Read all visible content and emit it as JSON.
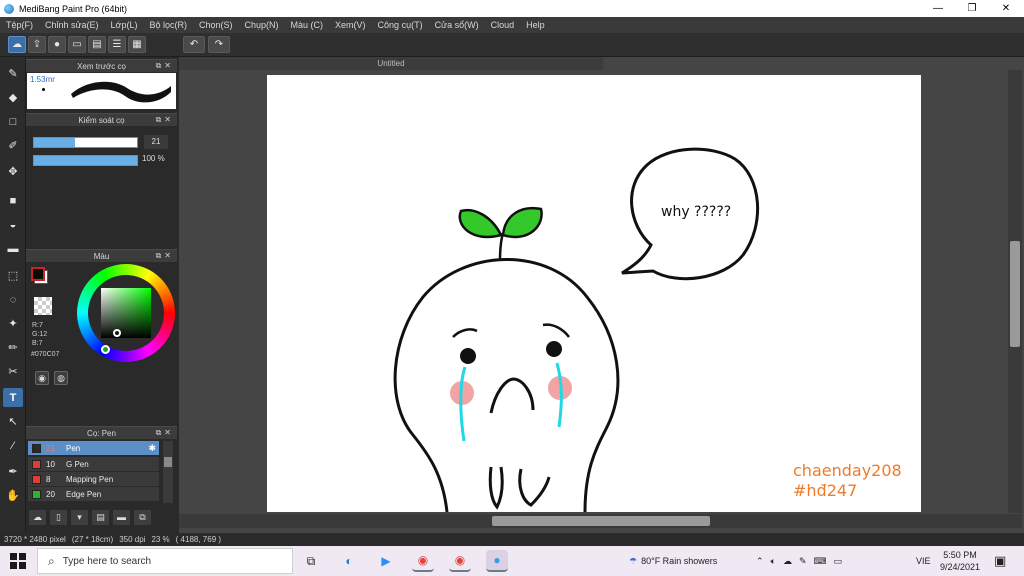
{
  "window": {
    "title": "MediBang Paint Pro (64bit)",
    "controls": [
      "—",
      "❐",
      "✕"
    ]
  },
  "menu": [
    "Tệp(F)",
    "Chỉnh sửa(E)",
    "Lớp(L)",
    "Bộ lọc(R)",
    "Chọn(S)",
    "Chụp(N)",
    "Màu (C)",
    "Xem(V)",
    "Công cụ(T)",
    "Cửa sổ(W)",
    "Cloud",
    "Help"
  ],
  "toolbar": {
    "icons": [
      "cloud-icon",
      "share-icon",
      "comment-icon",
      "chat-icon",
      "doc-icon",
      "list-icon",
      "grid-icon",
      "undo-icon",
      "redo-icon"
    ]
  },
  "tools": {
    "active": "text-tool",
    "items": [
      "brush-tool",
      "eraser-tool",
      "shape-tool",
      "pen-tool",
      "move-tool",
      "fill-rect-tool",
      "bucket-tool",
      "gradient-tool",
      "select-tool",
      "lasso-tool",
      "magic-wand-tool",
      "select-pen-tool",
      "select-eraser-tool",
      "text-tool",
      "operation-tool",
      "dropper-tool",
      "divide-tool",
      "hand-tool"
    ]
  },
  "panels": {
    "preview": {
      "title": "Xem trước cọ",
      "size_label": "1.53mr"
    },
    "brush_control": {
      "title": "Kiểm soát cọ",
      "size": "21",
      "opacity": "100 %",
      "size_fill": 0.4,
      "opacity_fill": 1.0
    },
    "color": {
      "title": "Màu",
      "r": "R:7",
      "g": "G:12",
      "b": "B:7",
      "hex": "#070C07",
      "fg": "#070c07",
      "bg": "#ffffff"
    },
    "brushes": {
      "title": "Cọ: Pen",
      "items": [
        {
          "size": "21",
          "name": "Pen",
          "color": "#2a2a2a"
        },
        {
          "size": "10",
          "name": "G Pen",
          "color": "#e53a3a"
        },
        {
          "size": "8",
          "name": "Mapping Pen",
          "color": "#e53a3a"
        },
        {
          "size": "20",
          "name": "Edge Pen",
          "color": "#2ab52a"
        }
      ]
    }
  },
  "document": {
    "tab": "Untitled",
    "speech": "why ?????",
    "signature_line1": "chaenday208",
    "signature_line2": "#hđ247",
    "signature_color": "#f07a2a"
  },
  "status": {
    "size": "3720 * 2480 pixel",
    "cm": "(27 * 18cm)",
    "dpi": "350 dpi",
    "zoom": "23 %",
    "coords": "( 4188, 769 )"
  },
  "taskbar": {
    "search_placeholder": "Type here to search",
    "weather": "80°F  Rain showers",
    "lang": "VIE",
    "time": "5:50 PM",
    "date": "9/24/2021"
  }
}
